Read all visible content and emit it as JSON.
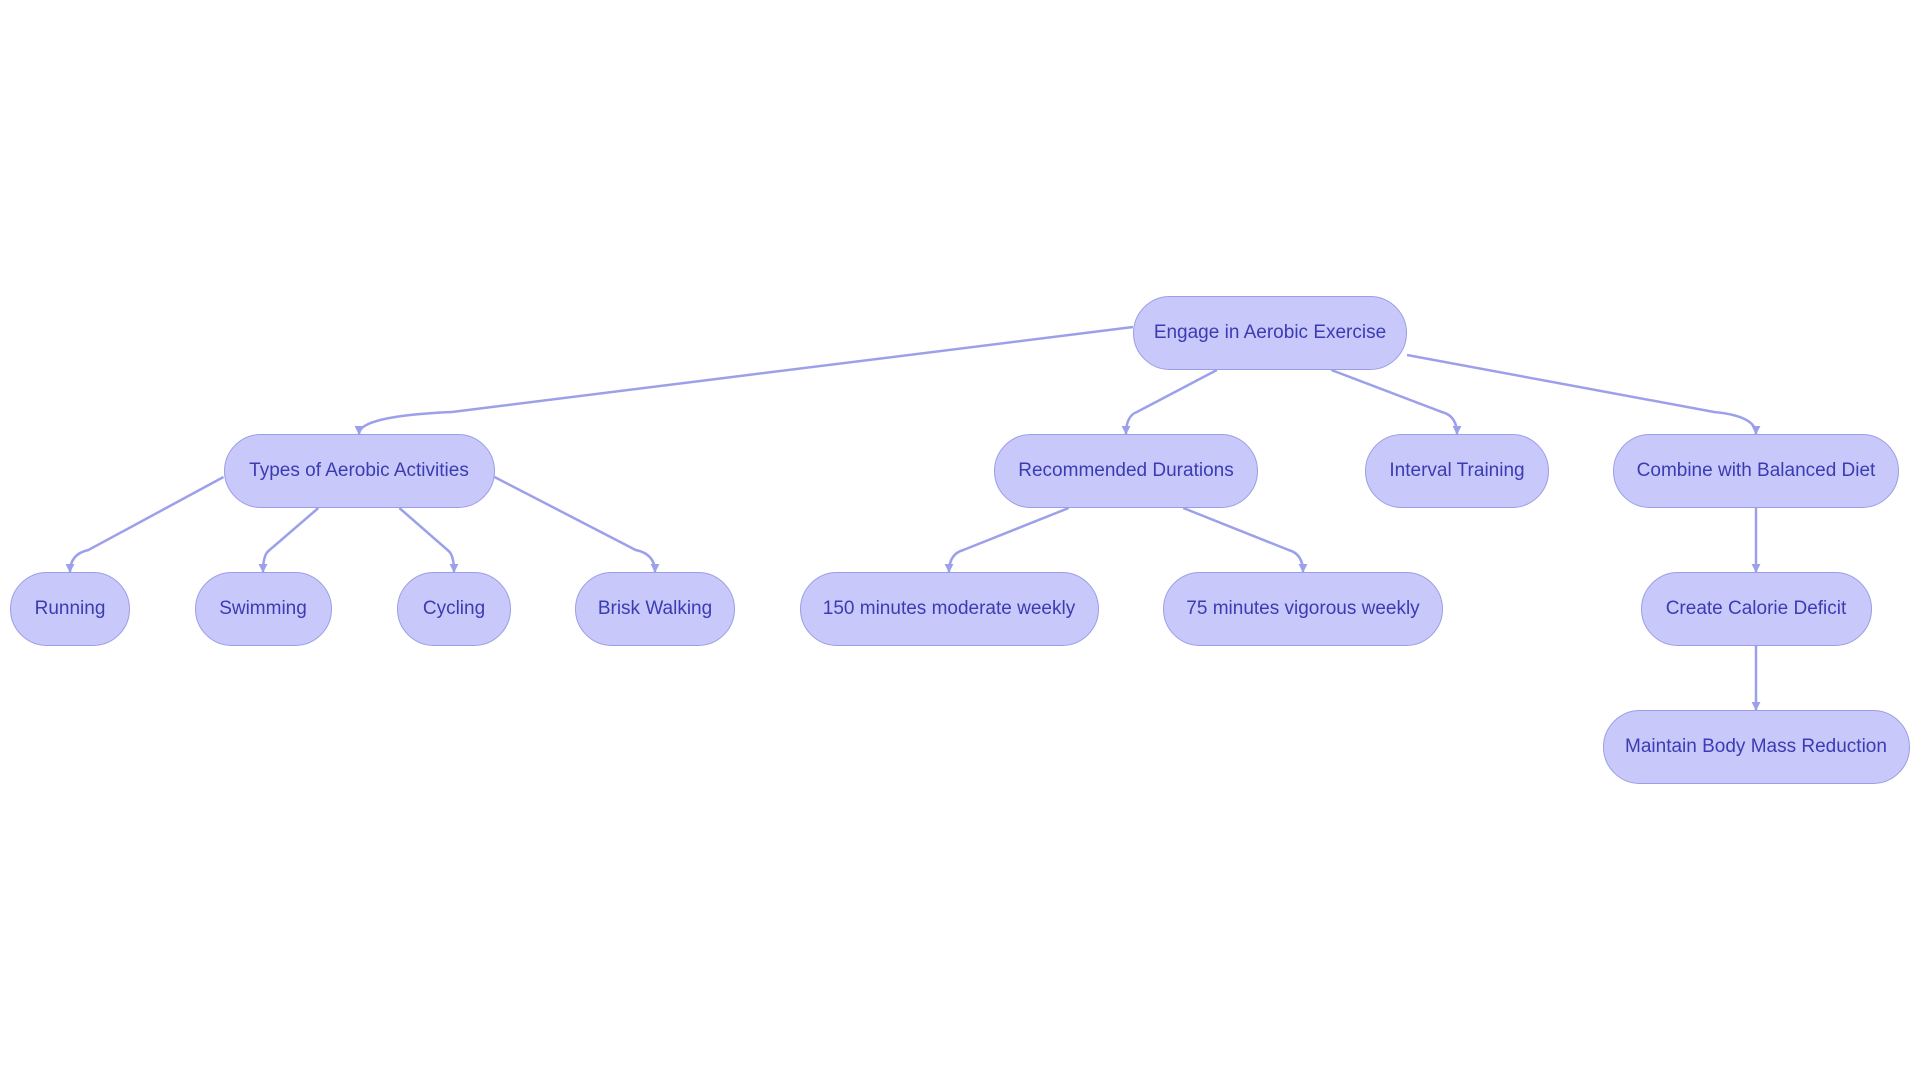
{
  "diagram": {
    "type": "flowchart",
    "colors": {
      "node_fill": "#c8c9fa",
      "node_border": "#9b9de6",
      "node_text": "#3b3bb4",
      "edge": "#9ca0eb",
      "background": "#ffffff"
    },
    "nodes": [
      {
        "id": "root",
        "label": "Engage in Aerobic Exercise"
      },
      {
        "id": "types",
        "label": "Types of Aerobic Activities"
      },
      {
        "id": "durations",
        "label": "Recommended Durations"
      },
      {
        "id": "interval",
        "label": "Interval Training"
      },
      {
        "id": "combine",
        "label": "Combine with Balanced Diet"
      },
      {
        "id": "running",
        "label": "Running"
      },
      {
        "id": "swimming",
        "label": "Swimming"
      },
      {
        "id": "cycling",
        "label": "Cycling"
      },
      {
        "id": "brisk",
        "label": "Brisk Walking"
      },
      {
        "id": "moderate",
        "label": "150 minutes moderate weekly"
      },
      {
        "id": "vigorous",
        "label": "75 minutes vigorous weekly"
      },
      {
        "id": "calorie",
        "label": "Create Calorie Deficit"
      },
      {
        "id": "maintain",
        "label": "Maintain Body Mass Reduction"
      }
    ],
    "edges": [
      {
        "from": "root",
        "to": "types"
      },
      {
        "from": "root",
        "to": "durations"
      },
      {
        "from": "root",
        "to": "interval"
      },
      {
        "from": "root",
        "to": "combine"
      },
      {
        "from": "types",
        "to": "running"
      },
      {
        "from": "types",
        "to": "swimming"
      },
      {
        "from": "types",
        "to": "cycling"
      },
      {
        "from": "types",
        "to": "brisk"
      },
      {
        "from": "durations",
        "to": "moderate"
      },
      {
        "from": "durations",
        "to": "vigorous"
      },
      {
        "from": "combine",
        "to": "calorie"
      },
      {
        "from": "calorie",
        "to": "maintain"
      }
    ]
  }
}
